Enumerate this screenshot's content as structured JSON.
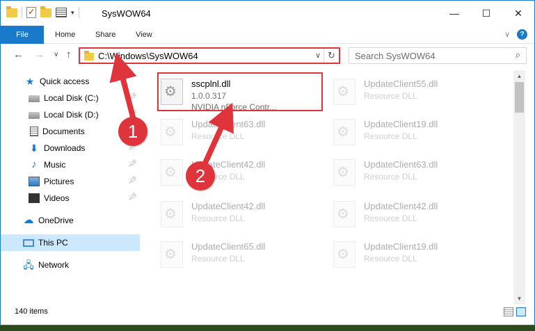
{
  "window": {
    "title": "SysWOW64",
    "controls": {
      "minimize": "—",
      "maximize": "☐",
      "close": "✕"
    }
  },
  "ribbon": {
    "tabs": [
      "File",
      "Home",
      "Share",
      "View"
    ]
  },
  "navigation": {
    "address": "C:\\Windows\\SysWOW64",
    "search_placeholder": "Search SysWOW64"
  },
  "sidebar": {
    "items": [
      {
        "label": "Quick access",
        "icon": "star-icon",
        "pinned": false
      },
      {
        "label": "Local Disk (C:)",
        "icon": "drive-icon",
        "pinned": true
      },
      {
        "label": "Local Disk (D:)",
        "icon": "drive-icon",
        "pinned": true
      },
      {
        "label": "Documents",
        "icon": "documents-icon",
        "pinned": true
      },
      {
        "label": "Downloads",
        "icon": "download-icon",
        "pinned": true
      },
      {
        "label": "Music",
        "icon": "music-icon",
        "pinned": true
      },
      {
        "label": "Pictures",
        "icon": "pictures-icon",
        "pinned": true
      },
      {
        "label": "Videos",
        "icon": "videos-icon",
        "pinned": true
      },
      {
        "label": "OneDrive",
        "icon": "cloud-icon",
        "pinned": false
      },
      {
        "label": "This PC",
        "icon": "pc-icon",
        "pinned": false,
        "selected": true
      },
      {
        "label": "Network",
        "icon": "network-icon",
        "pinned": false
      }
    ]
  },
  "files": {
    "highlighted": {
      "name": "sscplnl.dll",
      "version": "1.0.0.317",
      "description": "NVIDIA nForce Contr..."
    },
    "faded": [
      {
        "name": "UpdateClient55.dll",
        "type": "Resource DLL"
      },
      {
        "name": "UpdateClient63.dll",
        "type": "Resource DLL"
      },
      {
        "name": "UpdateClient19.dll",
        "type": "Resource DLL"
      },
      {
        "name": "UpdateClient42.dll",
        "type": "Resource DLL"
      },
      {
        "name": "UpdateClient63.dll",
        "type": "Resource DLL"
      },
      {
        "name": "UpdateClient42.dll",
        "type": "Resource DLL"
      },
      {
        "name": "UpdateClient42.dll",
        "type": "Resource DLL"
      },
      {
        "name": "UpdateClient65.dll",
        "type": "Resource DLL"
      },
      {
        "name": "UpdateClient19.dll",
        "type": "Resource DLL"
      }
    ]
  },
  "status": {
    "item_count": "140 items"
  },
  "annotations": {
    "badge_1": "1",
    "badge_2": "2",
    "color": "#e0343d"
  }
}
